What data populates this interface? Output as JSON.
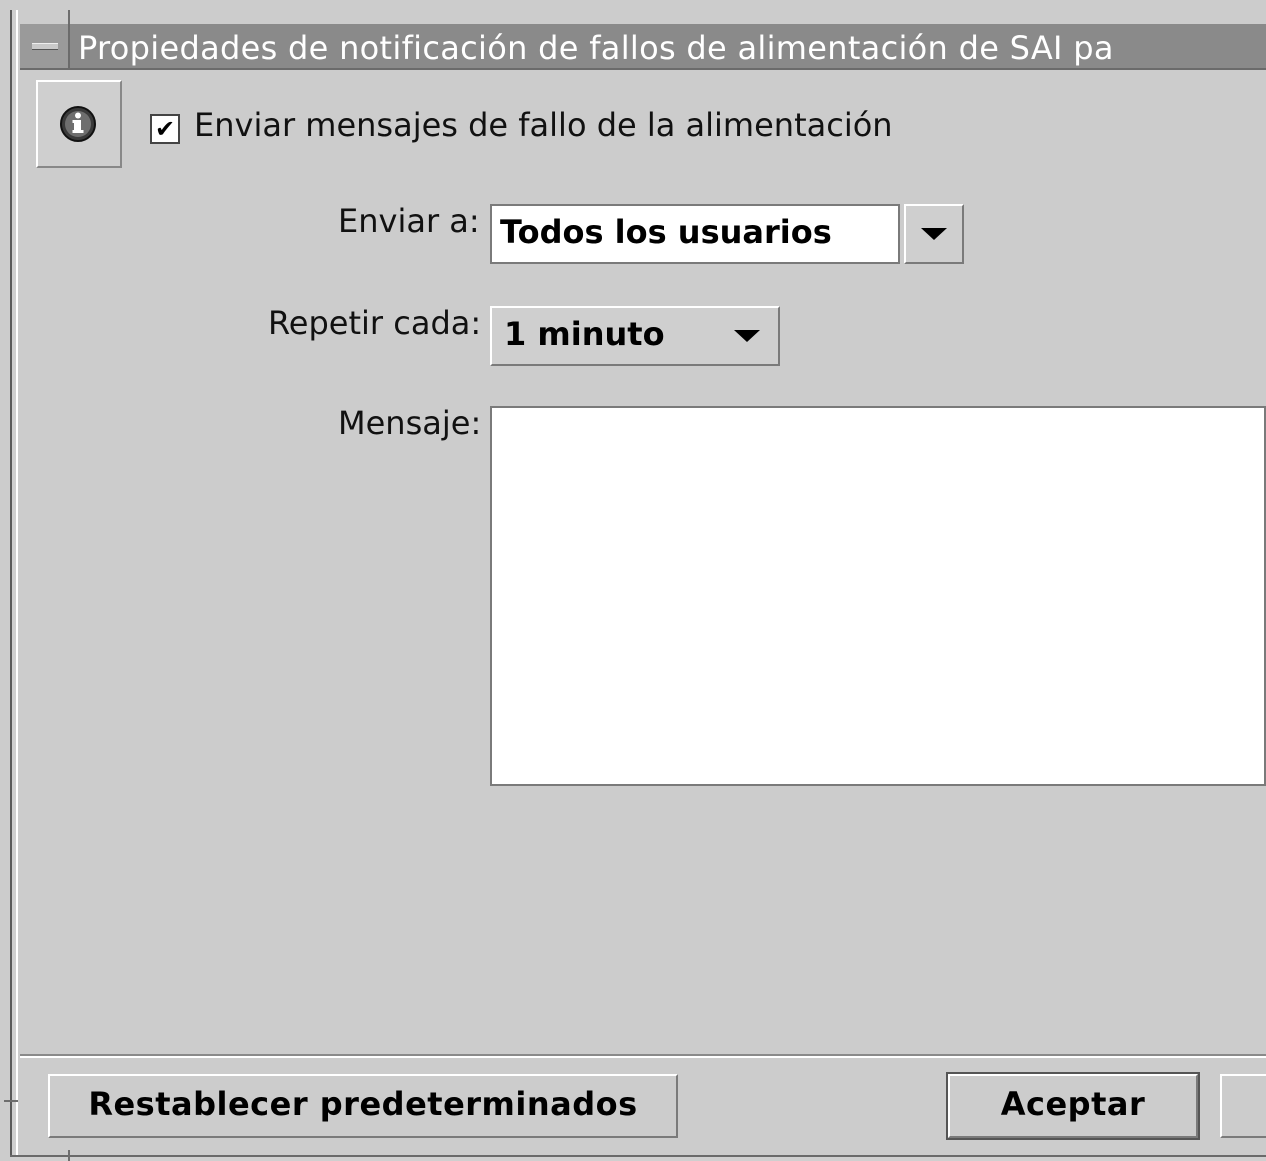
{
  "window": {
    "title": "Propiedades de notificación de fallos de alimentación de SAI pa"
  },
  "notification": {
    "send_checkbox_label": "Enviar mensajes de fallo de la alimentación",
    "send_checked": true,
    "check_glyph": "✔"
  },
  "form": {
    "send_to_label": "Enviar a:",
    "send_to_value": "Todos los usuarios",
    "repeat_label": "Repetir cada:",
    "repeat_value": "1 minuto",
    "message_label": "Mensaje:",
    "message_value": ""
  },
  "buttons": {
    "reset_label": "Restablecer predeterminados",
    "accept_label": "Aceptar"
  },
  "icons": {
    "window_menu": "window-menu-icon",
    "info": "info-icon",
    "dropdown": "chevron-down-icon"
  }
}
